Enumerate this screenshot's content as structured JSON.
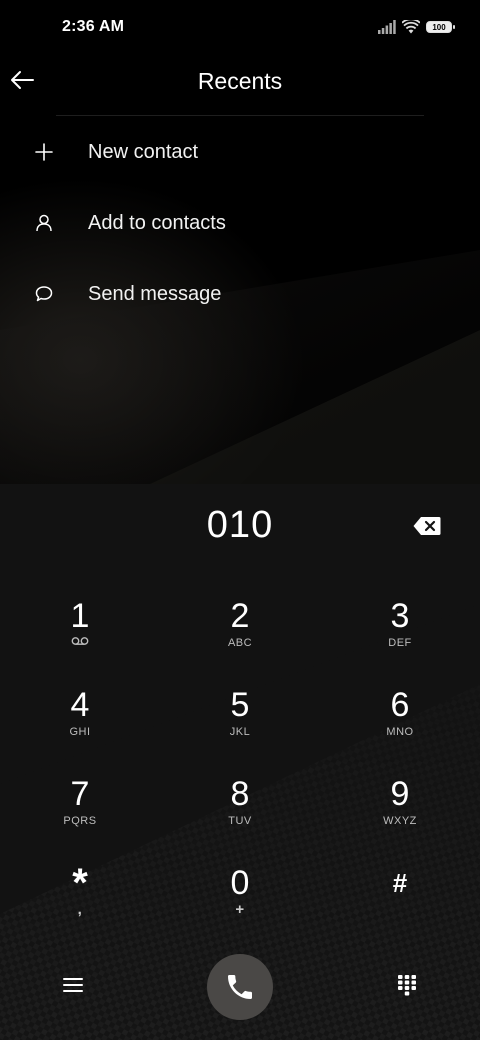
{
  "status_bar": {
    "time": "2:36 AM",
    "battery": "100"
  },
  "header": {
    "title": "Recents"
  },
  "menu": [
    {
      "label": "New contact",
      "icon": "plus-icon"
    },
    {
      "label": "Add to contacts",
      "icon": "person-icon"
    },
    {
      "label": "Send message",
      "icon": "message-icon"
    }
  ],
  "dialer": {
    "number": "010",
    "keys": [
      {
        "digit": "1",
        "letters": ""
      },
      {
        "digit": "2",
        "letters": "ABC"
      },
      {
        "digit": "3",
        "letters": "DEF"
      },
      {
        "digit": "4",
        "letters": "GHI"
      },
      {
        "digit": "5",
        "letters": "JKL"
      },
      {
        "digit": "6",
        "letters": "MNO"
      },
      {
        "digit": "7",
        "letters": "PQRS"
      },
      {
        "digit": "8",
        "letters": "TUV"
      },
      {
        "digit": "9",
        "letters": "WXYZ"
      },
      {
        "digit": "*",
        "letters": ","
      },
      {
        "digit": "0",
        "letters": "+"
      },
      {
        "digit": "#",
        "letters": ""
      }
    ]
  },
  "colors": {
    "background": "#000000",
    "keypad": "#121212",
    "call_button": "#4a4846",
    "text": "#ffffff"
  }
}
